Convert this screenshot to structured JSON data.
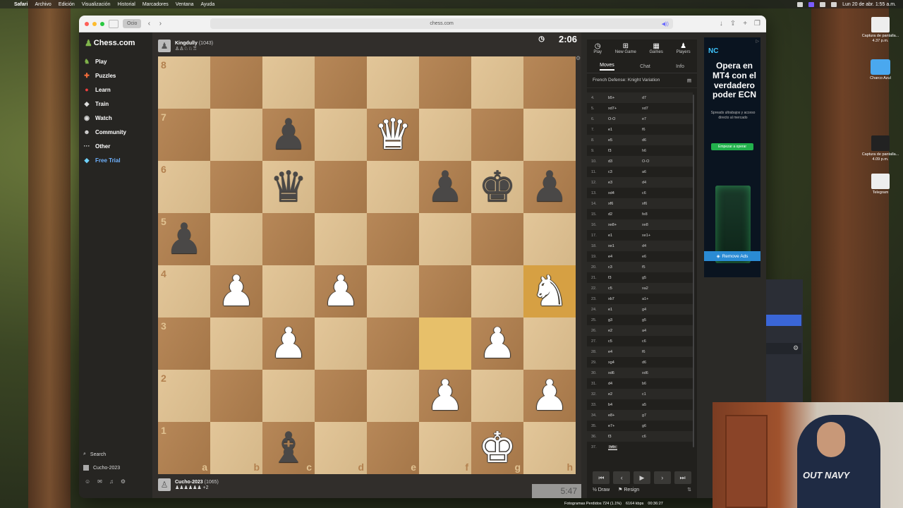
{
  "menubar": {
    "app": "Safari",
    "items": [
      "Archivo",
      "Edición",
      "Visualización",
      "Historial",
      "Marcadores",
      "Ventana",
      "Ayuda"
    ],
    "datetime": "Lun 20 de abr. 1:55 a.m."
  },
  "browser": {
    "tab_group": "Ocio",
    "url": "chess.com"
  },
  "sidebar": {
    "logo": "Chess.com",
    "items": [
      {
        "label": "Play",
        "icon": "play-icon"
      },
      {
        "label": "Puzzles",
        "icon": "puzzle-icon"
      },
      {
        "label": "Learn",
        "icon": "learn-icon"
      },
      {
        "label": "Train",
        "icon": "train-icon"
      },
      {
        "label": "Watch",
        "icon": "watch-icon"
      },
      {
        "label": "Community",
        "icon": "community-icon"
      },
      {
        "label": "Other",
        "icon": "more-icon"
      },
      {
        "label": "Free Trial",
        "icon": "diamond-icon"
      }
    ],
    "search_label": "Search",
    "username": "Cucho-2023"
  },
  "top_player": {
    "name": "Kingdully",
    "rating": "(1043)",
    "captured": "♙♙♘♘♖",
    "clock": "2:06"
  },
  "bottom_player": {
    "name": "Cucho-2023",
    "rating": "(1065)",
    "captured": "♟♟♟♟♟♟ +2",
    "clock": "5:47"
  },
  "board": {
    "ranks": [
      "8",
      "7",
      "6",
      "5",
      "4",
      "3",
      "2",
      "1"
    ],
    "files": [
      "a",
      "b",
      "c",
      "d",
      "e",
      "f",
      "g",
      "h"
    ],
    "squares": [
      [
        "",
        "",
        "",
        "",
        "",
        "",
        "",
        ""
      ],
      [
        "",
        "",
        "bp",
        "",
        "wq",
        "",
        "",
        ""
      ],
      [
        "",
        "",
        "bq",
        "",
        "",
        "bp",
        "bk",
        "bp"
      ],
      [
        "bp",
        "",
        "",
        "",
        "",
        "",
        "",
        ""
      ],
      [
        "",
        "wp",
        "",
        "wp",
        "",
        "",
        "",
        "wn"
      ],
      [
        "",
        "",
        "wp",
        "",
        "",
        "",
        "wp",
        ""
      ],
      [
        "",
        "",
        "",
        "",
        "",
        "wp",
        "",
        "wp"
      ],
      [
        "",
        "",
        "bb",
        "",
        "",
        "",
        "wk",
        ""
      ]
    ],
    "highlights": [
      "f3",
      "h4"
    ]
  },
  "panel": {
    "tabs": [
      {
        "label": "Play",
        "icon": "clock-icon"
      },
      {
        "label": "New Game",
        "icon": "plus-icon"
      },
      {
        "label": "Games",
        "icon": "games-icon"
      },
      {
        "label": "Players",
        "icon": "players-icon"
      }
    ],
    "subtabs": [
      "Moves",
      "Chat",
      "Info"
    ],
    "opening": "French Defense: Knight Variation",
    "moves": [
      {
        "n": "4.",
        "w": "b5+",
        "b": "d7"
      },
      {
        "n": "5.",
        "w": "xd7+",
        "b": "xd7"
      },
      {
        "n": "6.",
        "w": "O-O",
        "b": "e7"
      },
      {
        "n": "7.",
        "w": "e1",
        "b": "f6"
      },
      {
        "n": "8.",
        "w": "e5",
        "b": "d6"
      },
      {
        "n": "9.",
        "w": "f3",
        "b": "h6"
      },
      {
        "n": "10.",
        "w": "d3",
        "b": "O-O"
      },
      {
        "n": "11.",
        "w": "c3",
        "b": "a6"
      },
      {
        "n": "12.",
        "w": "e3",
        "b": "d4"
      },
      {
        "n": "13.",
        "w": "xd4",
        "b": "c6"
      },
      {
        "n": "14.",
        "w": "xf6",
        "b": "xf6"
      },
      {
        "n": "15.",
        "w": "d2",
        "b": "fe8"
      },
      {
        "n": "16.",
        "w": "xe8+",
        "b": "xe8"
      },
      {
        "n": "17.",
        "w": "e1",
        "b": "xe1+"
      },
      {
        "n": "18.",
        "w": "xe1",
        "b": "d4"
      },
      {
        "n": "19.",
        "w": "e4",
        "b": "e6"
      },
      {
        "n": "20.",
        "w": "c3",
        "b": "f5"
      },
      {
        "n": "21.",
        "w": "f3",
        "b": "g5"
      },
      {
        "n": "22.",
        "w": "c5",
        "b": "xa2"
      },
      {
        "n": "23.",
        "w": "xb7",
        "b": "a1+"
      },
      {
        "n": "24.",
        "w": "e1",
        "b": "g4"
      },
      {
        "n": "25.",
        "w": "g3",
        "b": "g5"
      },
      {
        "n": "26.",
        "w": "e2",
        "b": "a4"
      },
      {
        "n": "27.",
        "w": "c5",
        "b": "c6"
      },
      {
        "n": "28.",
        "w": "e4",
        "b": "f6"
      },
      {
        "n": "29.",
        "w": "xg4",
        "b": "d6"
      },
      {
        "n": "30.",
        "w": "xd6",
        "b": "xd6"
      },
      {
        "n": "31.",
        "w": "d4",
        "b": "b6"
      },
      {
        "n": "32.",
        "w": "e2",
        "b": "c1"
      },
      {
        "n": "33.",
        "w": "b4",
        "b": "a5"
      },
      {
        "n": "34.",
        "w": "e8+",
        "b": "g7"
      },
      {
        "n": "35.",
        "w": "e7+",
        "b": "g6"
      },
      {
        "n": "36.",
        "w": "f3",
        "b": "c6"
      },
      {
        "n": "37.",
        "w": "h4+",
        "b": ""
      }
    ],
    "actions": {
      "draw": "Draw",
      "resign": "Resign"
    }
  },
  "ad": {
    "brand": "NC",
    "headline": "Opera en MT4 con el verdadero poder ECN",
    "sub": "Spreads ultrabajos y acceso directo al mercado",
    "cta": "Empezar a operar",
    "remove": "Remove Ads"
  },
  "desktop": {
    "icons": [
      {
        "label": "Captura de pantalla... 4.37 p.m."
      },
      {
        "label": "Charco Azul"
      },
      {
        "label": "Captura de pantalla... 4.09 p.m."
      },
      {
        "label": "Telegram"
      }
    ]
  },
  "status": {
    "dropped": "Fotogramas Perdidos 724 (1.1%)",
    "bitrate": "6164 kbps",
    "time": "00:36:27"
  },
  "webcam": {
    "shirt_text": "OUT NAVY"
  }
}
